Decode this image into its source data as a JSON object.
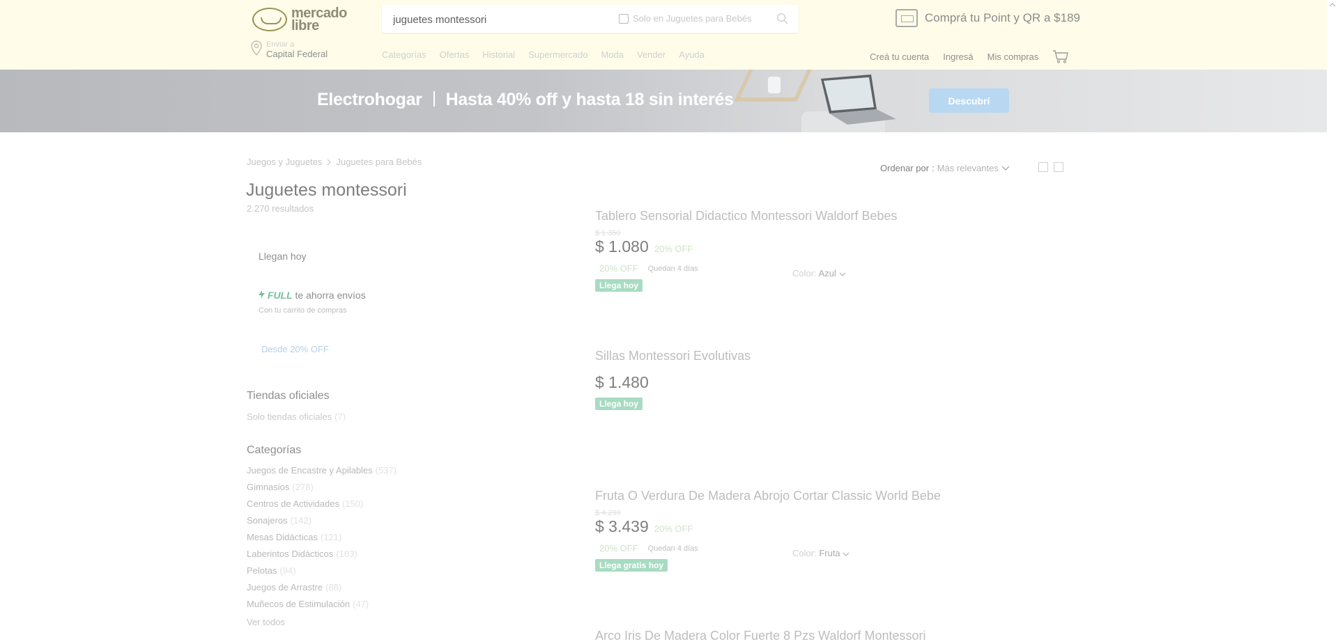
{
  "header": {
    "logo_line1": "mercado",
    "logo_line2": "libre",
    "search_value": "juguetes montessori",
    "search_scope": "Solo en Juguetes para Bebés",
    "promo": "Comprá tu Point y QR a $189",
    "location_label": "Enviar a",
    "location_value": "Capital Federal",
    "nav": [
      "Categorías",
      "Ofertas",
      "Historial",
      "Supermercado",
      "Moda",
      "Vender",
      "Ayuda"
    ],
    "user_nav": [
      "Creá tu cuenta",
      "Ingresá",
      "Mis compras"
    ]
  },
  "banner": {
    "left": "Electrohogar",
    "right": "Hasta 40% off y hasta 18 sin interés",
    "cta": "Descubrí"
  },
  "breadcrumb": [
    "Juegos y Juguetes",
    "Juguetes para Bebés"
  ],
  "page": {
    "title": "Juguetes montessori",
    "results": "2.270 resultados"
  },
  "sort": {
    "label": "Ordenar por",
    "value": "Más relevantes"
  },
  "filters": {
    "llegan_hoy": "Llegan hoy",
    "full_brand": "FULL",
    "full_text": "te ahorra envíos",
    "full_sub": "Con tu carrito de compras",
    "desde": "Desde 20% OFF",
    "tiendas_title": "Tiendas oficiales",
    "tiendas_item": "Solo tiendas oficiales",
    "tiendas_count": "(7)",
    "categorias_title": "Categorías",
    "categorias": [
      {
        "name": "Juegos de Encastre y Apilables",
        "count": "(537)"
      },
      {
        "name": "Gimnasios",
        "count": "(278)"
      },
      {
        "name": "Centros de Actividades",
        "count": "(150)"
      },
      {
        "name": "Sonajeros",
        "count": "(142)"
      },
      {
        "name": "Mesas Didácticas",
        "count": "(121)"
      },
      {
        "name": "Laberintos Didácticos",
        "count": "(103)"
      },
      {
        "name": "Pelotas",
        "count": "(94)"
      },
      {
        "name": "Juegos de Arrastre",
        "count": "(88)"
      },
      {
        "name": "Muñecos de Estimulación",
        "count": "(47)"
      }
    ],
    "ver_todos": "Ver todos"
  },
  "products": [
    {
      "title": "Tablero Sensorial Didactico Montessori Waldorf Bebes",
      "old_price": "$ 1.350",
      "price": "$ 1.080",
      "off": "20% OFF",
      "row_off": "20% OFF",
      "cuotas": "Quedan 4 días",
      "color_label": "Color:",
      "color_value": "Azul",
      "badge": "Llega hoy"
    },
    {
      "title": "Sillas Montessori Evolutivas",
      "price": "$ 1.480",
      "badge": "Llega hoy"
    },
    {
      "title": "Fruta O Verdura De Madera Abrojo Cortar Classic World Bebe",
      "old_price": "$ 4.299",
      "price": "$ 3.439",
      "off": "20% OFF",
      "row_off": "20% OFF",
      "cuotas": "Quedan 4 días",
      "color_label": "Color:",
      "color_value": "Fruta",
      "badge": "Llega gratis hoy"
    },
    {
      "title": "Arco Iris De Madera Color Fuerte 8 Pzs Waldorf Montessori"
    }
  ]
}
